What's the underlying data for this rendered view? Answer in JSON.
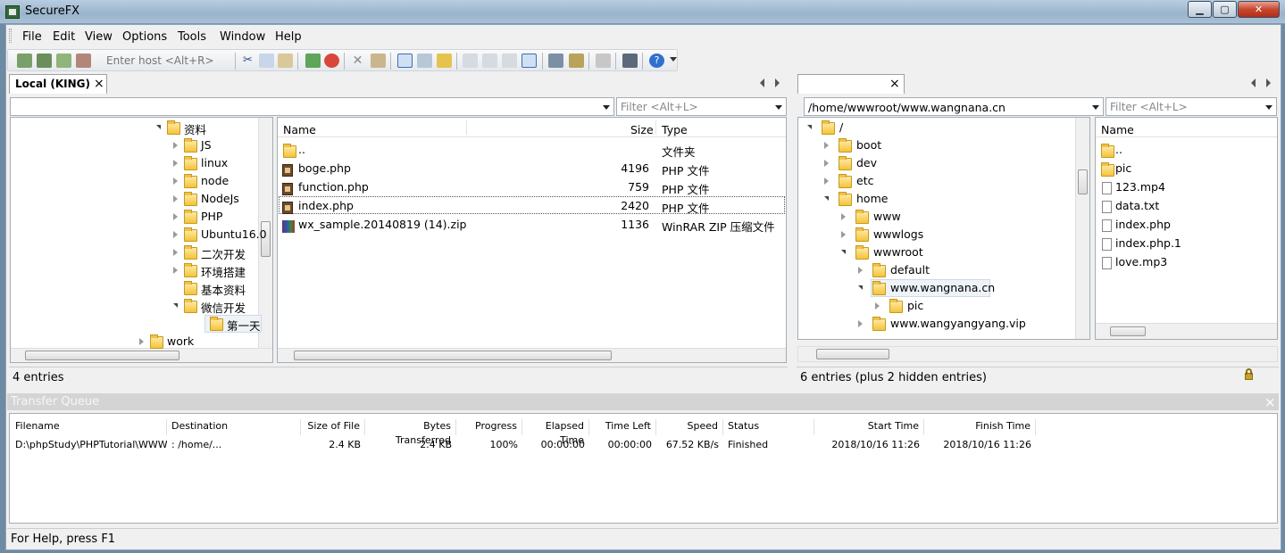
{
  "window": {
    "title": "SecureFX",
    "min": "▁",
    "max": "▢",
    "close": "✕"
  },
  "menu": [
    "File",
    "Edit",
    "View",
    "Options",
    "Tools",
    "Window",
    "Help"
  ],
  "toolbar": {
    "host_placeholder": "Enter host <Alt+R>"
  },
  "left": {
    "tab": "Local (KING)",
    "tab_close": "×",
    "filter": "Filter <Alt+L>",
    "tree": [
      {
        "label": "资料",
        "state": "open"
      },
      {
        "label": "JS",
        "state": "closed"
      },
      {
        "label": "linux",
        "state": "closed"
      },
      {
        "label": "node",
        "state": "closed"
      },
      {
        "label": "NodeJs",
        "state": "closed"
      },
      {
        "label": "PHP",
        "state": "closed"
      },
      {
        "label": "Ubuntu16.0",
        "state": "closed"
      },
      {
        "label": "二次开发",
        "state": "closed"
      },
      {
        "label": "环境搭建",
        "state": "closed"
      },
      {
        "label": "基本资料",
        "state": "none"
      },
      {
        "label": "微信开发",
        "state": "open"
      },
      {
        "label": "第一天",
        "state": "selected"
      },
      {
        "label": "work",
        "state": "closed"
      }
    ],
    "columns": {
      "name": "Name",
      "size": "Size",
      "type": "Type"
    },
    "files": [
      {
        "name": "..",
        "size": "",
        "type": "文件夹",
        "icon": "folder"
      },
      {
        "name": "boge.php",
        "size": "4196",
        "type": "PHP 文件",
        "icon": "php"
      },
      {
        "name": "function.php",
        "size": "759",
        "type": "PHP 文件",
        "icon": "php"
      },
      {
        "name": "index.php",
        "size": "2420",
        "type": "PHP 文件",
        "icon": "php"
      },
      {
        "name": "wx_sample.20140819 (14).zip",
        "size": "1136",
        "type": "WinRAR ZIP 压缩文件",
        "icon": "zip"
      }
    ],
    "status": "4 entries"
  },
  "right": {
    "tab_close": "×",
    "path": "/home/wwwroot/www.wangnana.cn",
    "filter": "Filter <Alt+L>",
    "tree": [
      {
        "label": "/",
        "state": "open"
      },
      {
        "label": "boot",
        "state": "closed"
      },
      {
        "label": "dev",
        "state": "closed"
      },
      {
        "label": "etc",
        "state": "closed"
      },
      {
        "label": "home",
        "state": "open"
      },
      {
        "label": "www",
        "state": "closed"
      },
      {
        "label": "wwwlogs",
        "state": "closed"
      },
      {
        "label": "wwwroot",
        "state": "open"
      },
      {
        "label": "default",
        "state": "closed"
      },
      {
        "label": "www.wangnana.cn",
        "state": "open-selected"
      },
      {
        "label": "pic",
        "state": "closed"
      },
      {
        "label": "www.wangyangyang.vip",
        "state": "closed"
      }
    ],
    "columns": {
      "name": "Name"
    },
    "files": [
      {
        "name": "..",
        "icon": "folder"
      },
      {
        "name": "pic",
        "icon": "folder"
      },
      {
        "name": "123.mp4",
        "icon": "file"
      },
      {
        "name": "data.txt",
        "icon": "file"
      },
      {
        "name": "index.php",
        "icon": "file"
      },
      {
        "name": "index.php.1",
        "icon": "file"
      },
      {
        "name": "love.mp3",
        "icon": "file"
      }
    ],
    "status": "6 entries (plus 2 hidden entries)"
  },
  "queue": {
    "title": "Transfer Queue",
    "close": "×",
    "columns": [
      "Filename",
      "Destination",
      "Size of File",
      "Bytes Transferred",
      "Progress",
      "Elapsed Time",
      "Time Left",
      "Speed",
      "Status",
      "Start Time",
      "Finish Time"
    ],
    "rows": [
      [
        "D:\\phpStudy\\PHPTutorial\\WWW...",
        ": /home/...",
        "2.4 KB",
        "2.4 KB",
        "100%",
        "00:00:00",
        "00:00:00",
        "67.52 KB/s",
        "Finished",
        "2018/10/16 11:26",
        "2018/10/16 11:26"
      ]
    ]
  },
  "statusbar": "For Help, press F1"
}
